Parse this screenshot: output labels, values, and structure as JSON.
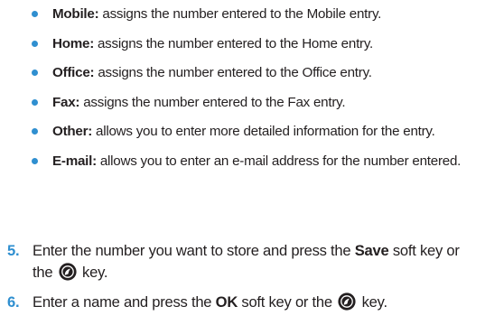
{
  "bullets": [
    {
      "term": "Mobile:",
      "text": " assigns the number entered to the Mobile entry."
    },
    {
      "term": "Home:",
      "text": " assigns the number entered to the Home entry."
    },
    {
      "term": "Office:",
      "text": " assigns the number entered to the Office entry."
    },
    {
      "term": "Fax:",
      "text": " assigns the number entered to the Fax entry."
    },
    {
      "term": "Other:",
      "text": " allows you to enter more detailed information for the entry."
    },
    {
      "term": "E-mail:",
      "text": " allows you to enter an e-mail address for the number entered."
    }
  ],
  "steps": [
    {
      "number": "5.",
      "text_before": "Enter the number you want to store and press the ",
      "key": "Save",
      "text_after": " soft key or the ",
      "icon": "ok-key-icon",
      "text_end": " key."
    },
    {
      "number": "6.",
      "text_before": "Enter a name and press the ",
      "key": "OK",
      "text_after": " soft key or the ",
      "icon": "ok-key-icon",
      "text_end": " key."
    }
  ],
  "colors": {
    "accent": "#2f8fd0",
    "text": "#231f20"
  }
}
